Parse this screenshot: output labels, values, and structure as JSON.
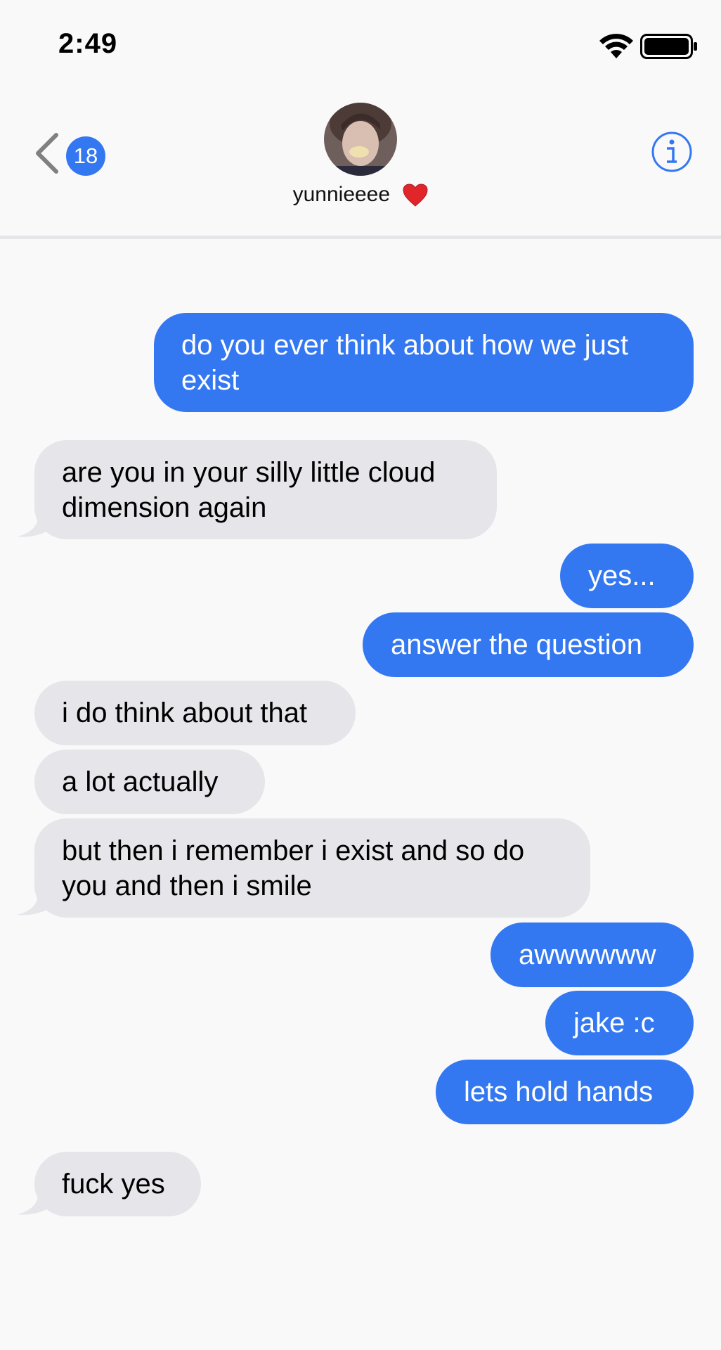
{
  "status_bar": {
    "time": "2:49"
  },
  "header": {
    "back_badge": "18",
    "contact_name": "yunnieeee"
  },
  "messages": [
    {
      "from": "me",
      "text": "do you ever think about how we just\nexist"
    },
    {
      "from": "them",
      "text": "are you in your silly little cloud\ndimension again"
    },
    {
      "from": "me",
      "text": "yes..."
    },
    {
      "from": "me",
      "text": "answer the question"
    },
    {
      "from": "them",
      "text": "i do think about that"
    },
    {
      "from": "them",
      "text": "a lot actually"
    },
    {
      "from": "them",
      "text": "but then i remember i exist and so do\nyou and then i smile"
    },
    {
      "from": "me",
      "text": "awwwwww"
    },
    {
      "from": "me",
      "text": "jake :c"
    },
    {
      "from": "me",
      "text": "lets hold hands"
    },
    {
      "from": "them",
      "text": "fuck yes"
    }
  ],
  "colors": {
    "outgoing": "#3478f1",
    "incoming": "#e5e5ea",
    "accent": "#3478f1"
  }
}
